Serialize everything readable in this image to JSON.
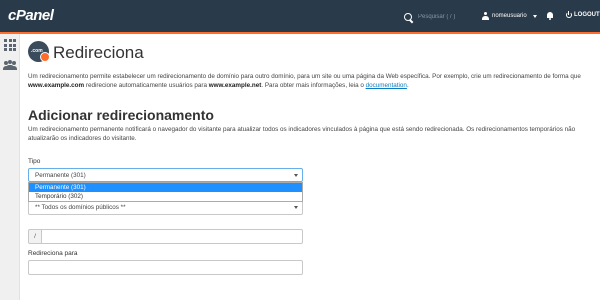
{
  "header": {
    "logo": "cPanel",
    "search_placeholder": "Pesquisar ( / )",
    "username": "nomeusuario",
    "logout_label": "LOGOUT",
    "colors": {
      "bar": "#293a4a",
      "accent": "#ff6c2c"
    }
  },
  "sidebar": {
    "items": [
      {
        "icon": "grid-icon"
      },
      {
        "icon": "users-icon"
      }
    ]
  },
  "page": {
    "icon_text": ".com",
    "title": "Redireciona",
    "intro": {
      "part1": "Um redirecionamento permite estabelecer um redirecionamento de domínio para outro domínio, para um site ou uma página da Web específica. Por exemplo, crie um redirecionamento de forma que ",
      "domain1": "www.example.com",
      "part2": " redirecione automaticamente usuários para ",
      "domain2": "www.example.net",
      "part3": ". Para obter mais informações, leia o ",
      "link": "documentation",
      "part4": "."
    }
  },
  "form": {
    "section_title": "Adicionar redirecionamento",
    "section_desc": "Um redirecionamento permanente notificará o navegador do visitante para atualizar todos os indicadores vinculados à página que está sendo redirecionada. Os redirecionamentos temporários não atualizarão os indicadores do visitante.",
    "type_label": "Tipo",
    "type_selected": "Permanente (301)",
    "type_options": [
      "Permanente (301)",
      "Temporário (302)"
    ],
    "domain_selected": "** Todos os domínios públicos **",
    "path_prefix": "/",
    "redirect_label": "Redireciona para"
  }
}
